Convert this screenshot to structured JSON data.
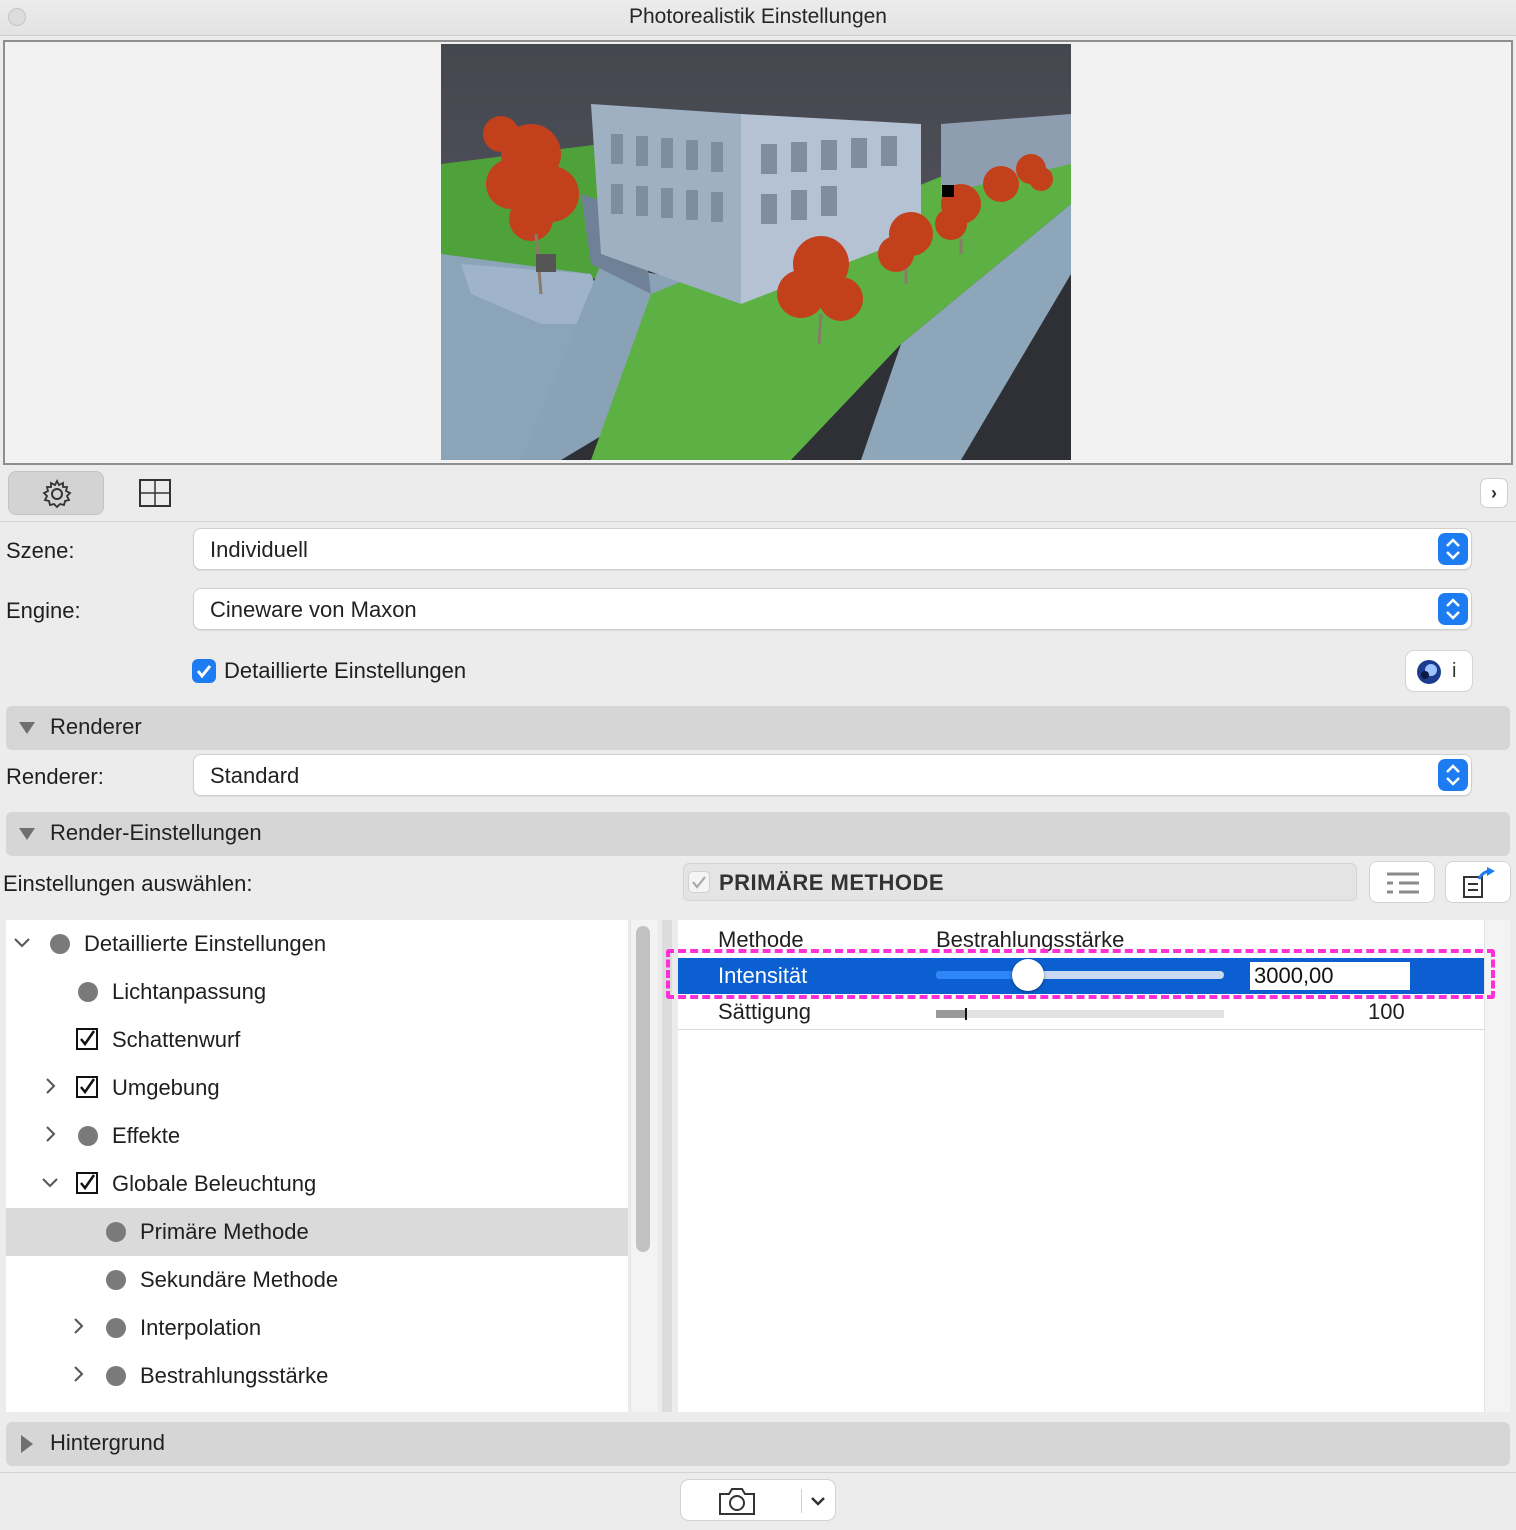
{
  "window": {
    "title": "Photorealistik Einstellungen"
  },
  "toolbar": {
    "settings_icon": "gear-icon",
    "crop_icon": "frame-crop-icon",
    "expand_icon": "chevron-right-icon",
    "expand_label": "›"
  },
  "scene": {
    "label": "Szene:",
    "value": "Individuell"
  },
  "engine": {
    "label": "Engine:",
    "value": "Cineware von Maxon"
  },
  "detailed": {
    "label": "Detaillierte Einstellungen",
    "checked": true
  },
  "sections": {
    "renderer": "Renderer",
    "render_settings": "Render-Einstellungen",
    "background": "Hintergrund"
  },
  "renderer": {
    "label": "Renderer:",
    "value": "Standard"
  },
  "select_settings": {
    "label": "Einstellungen auswählen:"
  },
  "method_header": {
    "title": "PRIMÄRE METHODE",
    "checked": true
  },
  "tree": {
    "items": [
      {
        "label": "Detaillierte Einstellungen",
        "marker": "dot",
        "expander": "expanded",
        "level": 0
      },
      {
        "label": "Lichtanpassung",
        "marker": "dot",
        "expander": "none",
        "level": 1
      },
      {
        "label": "Schattenwurf",
        "marker": "check",
        "expander": "none",
        "level": 1
      },
      {
        "label": "Umgebung",
        "marker": "check",
        "expander": "collapsed",
        "level": 1
      },
      {
        "label": "Effekte",
        "marker": "dot",
        "expander": "collapsed",
        "level": 1
      },
      {
        "label": "Globale Beleuchtung",
        "marker": "check",
        "expander": "expanded",
        "level": 1
      },
      {
        "label": "Primäre Methode",
        "marker": "dot",
        "expander": "none",
        "level": 2,
        "selected": true
      },
      {
        "label": "Sekundäre Methode",
        "marker": "dot",
        "expander": "none",
        "level": 2
      },
      {
        "label": "Interpolation",
        "marker": "dot",
        "expander": "collapsed",
        "level": 2
      },
      {
        "label": "Bestrahlungsstärke",
        "marker": "dot",
        "expander": "collapsed",
        "level": 2
      }
    ]
  },
  "properties": {
    "method": {
      "label": "Methode",
      "value": "Bestrahlungsstärke"
    },
    "intensity": {
      "label": "Intensität",
      "value": "3000,00",
      "slider_fraction": 0.32
    },
    "saturation": {
      "label": "Sättigung",
      "value": "100",
      "slider_fraction": 0.1
    }
  },
  "footer": {
    "camera_icon": "camera-icon",
    "dropdown_icon": "chevron-down-icon"
  },
  "colors": {
    "accent": "#1d7cf2",
    "selection": "#0b5fd0",
    "highlight_annotation": "#ff2fd8"
  }
}
